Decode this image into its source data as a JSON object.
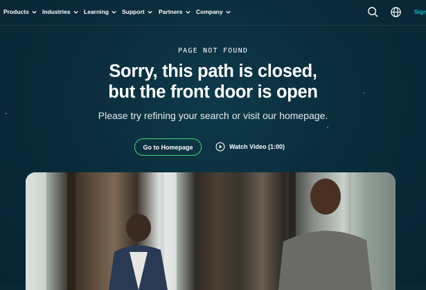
{
  "nav": {
    "items": [
      {
        "label": "Products"
      },
      {
        "label": "Industries"
      },
      {
        "label": "Learning"
      },
      {
        "label": "Support"
      },
      {
        "label": "Partners"
      },
      {
        "label": "Company"
      }
    ],
    "signin_label": "Sign"
  },
  "hero": {
    "eyebrow": "PAGE NOT FOUND",
    "headline_line1": "Sorry, this path is closed,",
    "headline_line2": "but the front door is open",
    "subtext": "Please try refining your search or visit our homepage.",
    "primary_button": "Go to Homepage",
    "video_button": "Watch Video (1:00)"
  },
  "colors": {
    "background": "#0a2c3b",
    "accent_green": "#3bdc7a",
    "accent_teal": "#22b8c7"
  },
  "icons": {
    "search": "search-icon",
    "language": "globe-icon",
    "play": "play-icon",
    "chevron": "chevron-down-icon"
  }
}
